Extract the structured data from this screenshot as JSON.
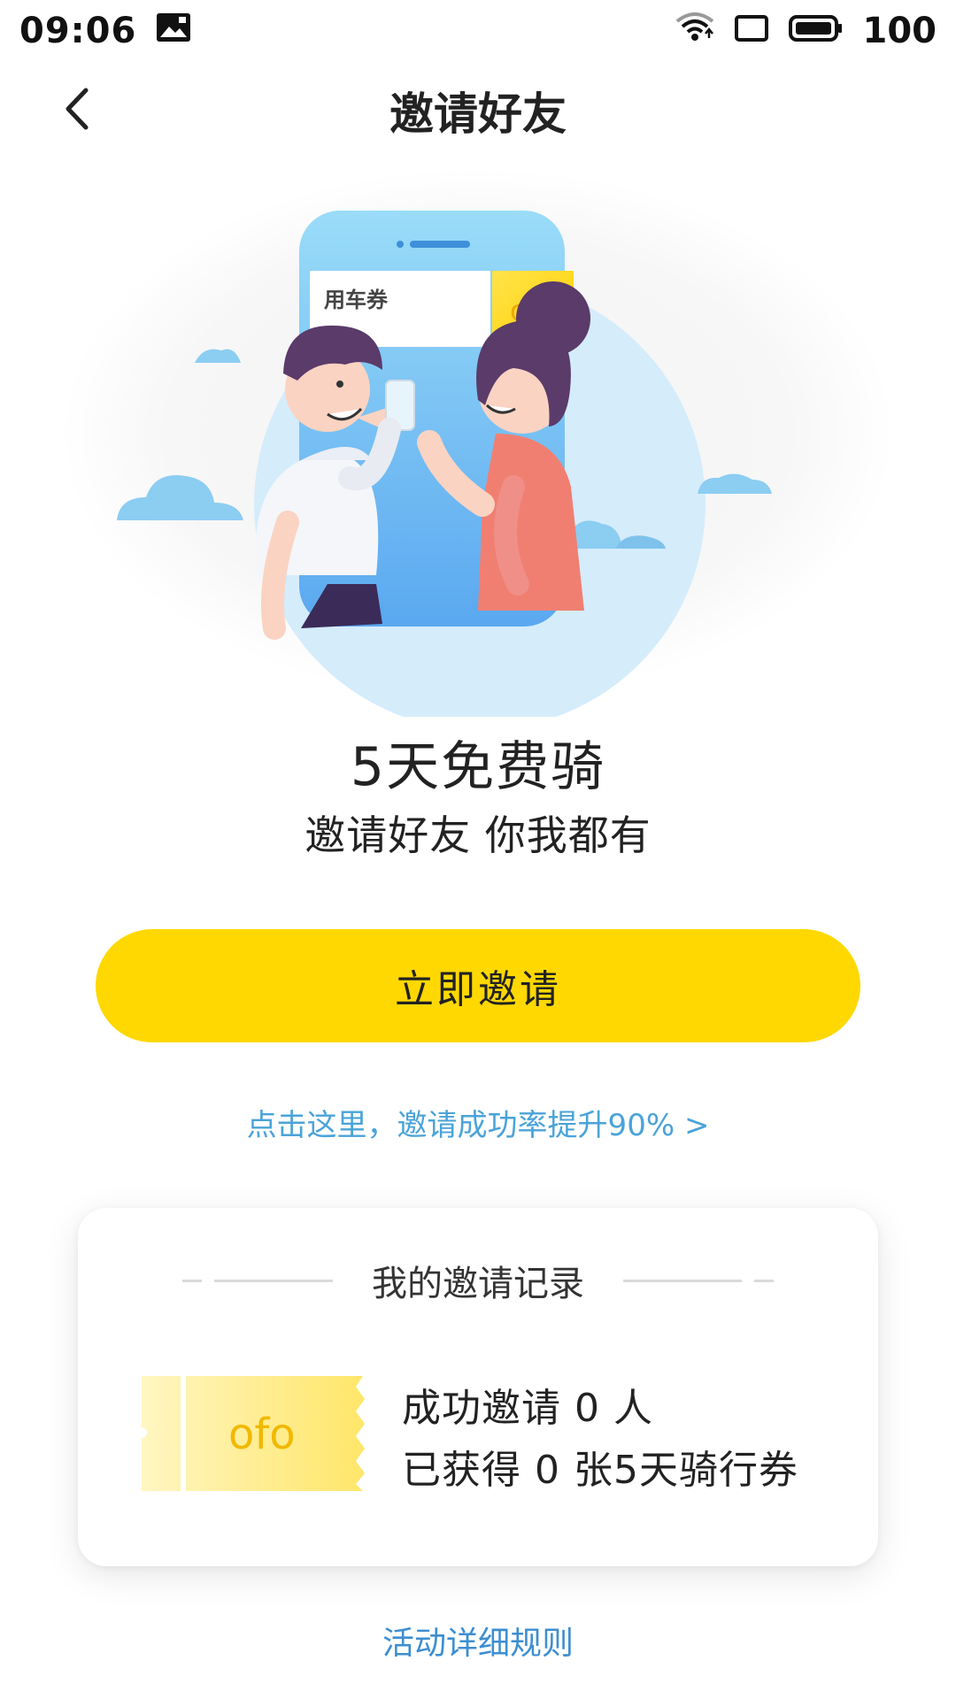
{
  "status_bar": {
    "time": "09:06",
    "battery_pct": "100",
    "icons": [
      "image-notification-icon",
      "wifi-icon",
      "screen-icon",
      "battery-icon"
    ]
  },
  "nav": {
    "title": "邀请好友",
    "back_icon": "chevron-left-icon"
  },
  "hero": {
    "coupon_label": "用车券",
    "brand": "ofo"
  },
  "promo": {
    "headline": "5天免费骑",
    "subheadline": "邀请好友 你我都有"
  },
  "invite_button_label": "立即邀请",
  "tip_link": "点击这里，邀请成功率提升90% >",
  "record": {
    "title": "我的邀请记录",
    "ticket_brand": "ofo",
    "line1": "成功邀请 0 人",
    "line2": "已获得 0 张5天骑行券"
  },
  "rules_link": "活动详细规则",
  "colors": {
    "accent_yellow": "#fed800",
    "link_blue": "#4aa3d8",
    "phone_blue": "#7ec8f2"
  }
}
